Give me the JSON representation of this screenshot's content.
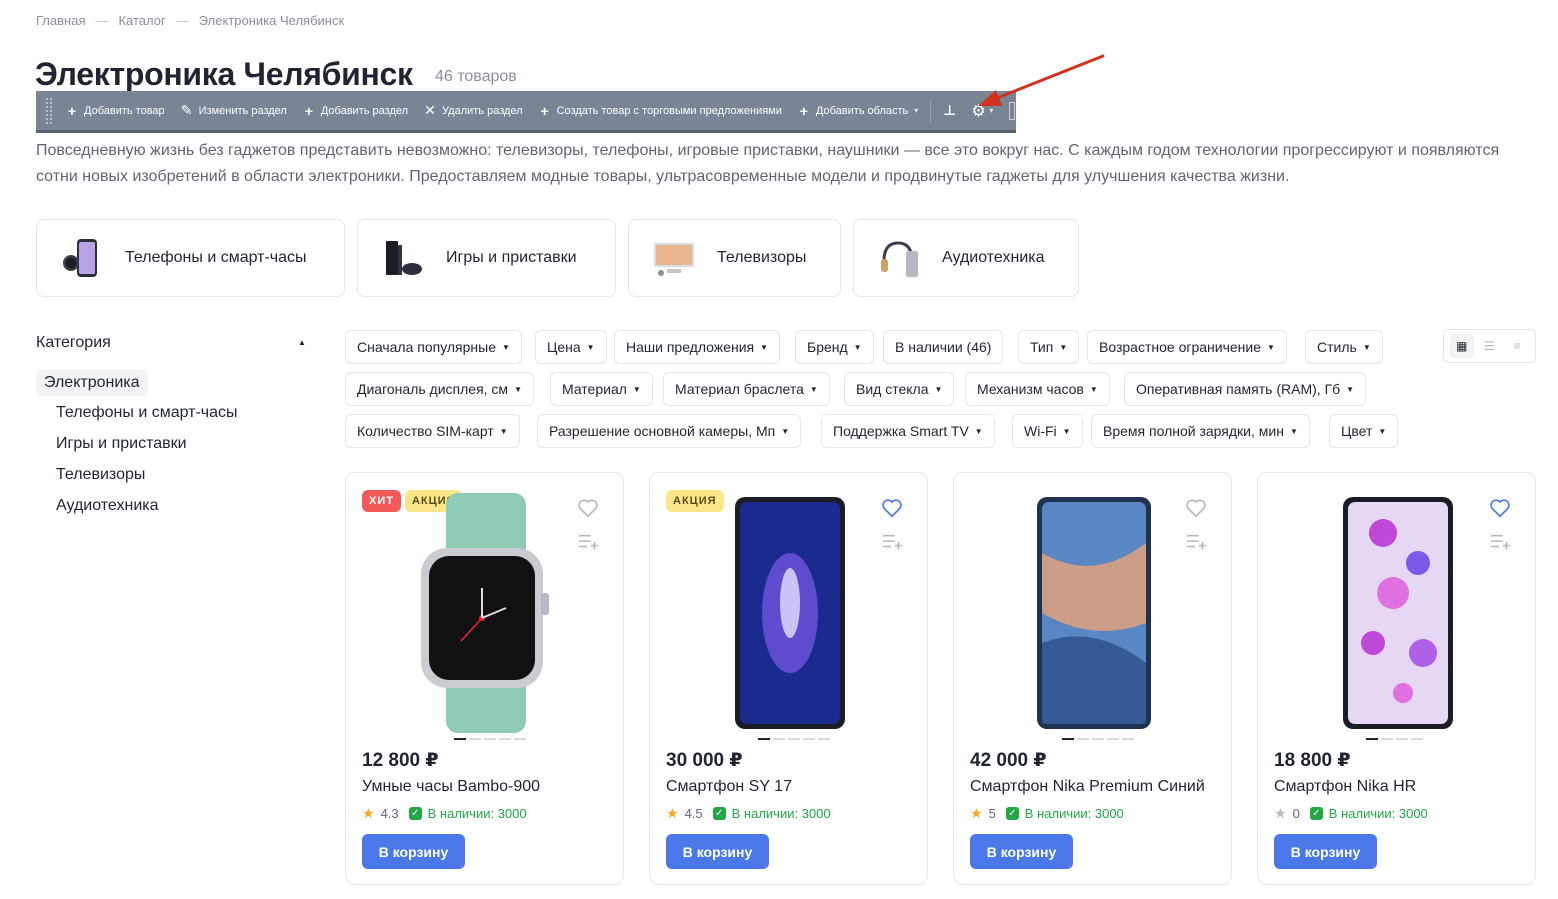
{
  "breadcrumb": {
    "items": [
      "Главная",
      "Каталог",
      "Электроника Челябинск"
    ],
    "separator": "—"
  },
  "page": {
    "title": "Электроника Челябинск",
    "count": "46 товаров"
  },
  "admin_toolbar": {
    "items": [
      {
        "icon": "plus-icon",
        "label": "Добавить товар"
      },
      {
        "icon": "pencil-icon",
        "label": "Изменить раздел"
      },
      {
        "icon": "plus-icon",
        "label": "Добавить раздел"
      },
      {
        "icon": "close-icon",
        "label": "Удалить раздел"
      },
      {
        "icon": "plus-icon",
        "label": "Создать товар с торговыми предложениями"
      },
      {
        "icon": "plus-icon",
        "label": "Добавить область"
      }
    ]
  },
  "description": "Повседневную жизнь без гаджетов представить невозможно: телевизоры, телефоны, игровые приставки, наушники — все это вокруг нас. С каждым годом технологии прогрессируют и появляются сотни новых изобретений в области электроники. Предоставляем модные товары, ультрасовременные модели и продвинутые гаджеты для улучшения качества жизни.",
  "categories": [
    {
      "label": "Телефоны и смарт-часы",
      "icon": "phone-watch-icon"
    },
    {
      "label": "Игры и приставки",
      "icon": "console-icon"
    },
    {
      "label": "Телевизоры",
      "icon": "tv-icon"
    },
    {
      "label": "Аудиотехника",
      "icon": "headphones-icon"
    }
  ],
  "sidebar": {
    "title": "Категория",
    "active": "Электроника",
    "items": [
      "Телефоны и смарт-часы",
      "Игры и приставки",
      "Телевизоры",
      "Аудиотехника"
    ]
  },
  "filters": {
    "row1": [
      "Сначала популярные",
      "Цена",
      "Наши предложения",
      "Бренд",
      "В наличии (46)",
      "Тип",
      "Возрастное ограничение",
      "Стиль"
    ],
    "row2": [
      "Диагональ дисплея, см",
      "Материал",
      "Материал браслета",
      "Вид стекла",
      "Механизм часов",
      "Оперативная память (RAM), Гб"
    ],
    "row3": [
      "Количество SIM-карт",
      "Разрешение основной камеры, Мп",
      "Поддержка Smart TV",
      "Wi-Fi",
      "Время полной зарядки, мин",
      "Цвет"
    ]
  },
  "view_modes": [
    "grid",
    "list",
    "table"
  ],
  "products": [
    {
      "badges": [
        "ХИТ",
        "АКЦИЯ"
      ],
      "price": "12 800 ₽",
      "name": "Умные часы Bambo-900",
      "rating": "4.3",
      "stock": "В наличии: 3000",
      "button": "В корзину",
      "favorite": false
    },
    {
      "badges": [
        "АКЦИЯ"
      ],
      "price": "30 000 ₽",
      "name": "Смартфон SY 17",
      "rating": "4.5",
      "stock": "В наличии: 3000",
      "button": "В корзину",
      "favorite": true
    },
    {
      "badges": [],
      "price": "42 000 ₽",
      "name": "Смартфон Nika Premium Синий",
      "rating": "5",
      "stock": "В наличии: 3000",
      "button": "В корзину",
      "favorite": false
    },
    {
      "badges": [],
      "price": "18 800 ₽",
      "name": "Смартфон Nika HR",
      "rating": "0",
      "stock": "В наличии: 3000",
      "button": "В корзину",
      "favorite": true
    }
  ],
  "colors": {
    "accent": "#4a78e8",
    "hit": "#f25a5a",
    "sale": "#fde68a",
    "stock": "#22a845",
    "toolbar": "#7a8593",
    "arrow": "#d0341f"
  }
}
